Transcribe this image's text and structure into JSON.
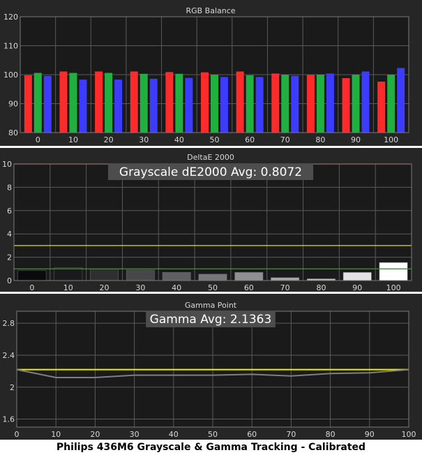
{
  "colors": {
    "background": "#262626",
    "plot_area": "#1a1a1a",
    "gridline": "#5a5a5a",
    "text": "#d9d9d9",
    "red": "#ff2b2b",
    "green": "#20b040",
    "blue": "#3c3cff",
    "threshold_red": "#e03c3c",
    "threshold_yellow": "#e6e600",
    "threshold_green": "#20a020",
    "gamma_line": "#7f7f7f",
    "gamma_target": "#f0f000",
    "annotation_box": "#4d4d4d"
  },
  "caption": "Philips 436M6 Grayscale & Gamma Tracking - Calibrated",
  "chart_data": [
    {
      "type": "bar",
      "title": "RGB Balance",
      "categories": [
        "0",
        "10",
        "20",
        "30",
        "40",
        "50",
        "60",
        "70",
        "80",
        "90",
        "100"
      ],
      "ylim": [
        80,
        120
      ],
      "yticks": [
        80,
        90,
        100,
        110,
        120
      ],
      "grid": true,
      "series": [
        {
          "color": "red",
          "values": [
            99.8,
            101.1,
            101.1,
            101.1,
            100.9,
            100.8,
            101.1,
            100.4,
            99.9,
            98.8,
            97.6
          ]
        },
        {
          "color": "green",
          "values": [
            100.6,
            100.6,
            100.6,
            100.3,
            100.3,
            100.0,
            99.8,
            100.0,
            100.0,
            100.0,
            100.0
          ]
        },
        {
          "color": "blue",
          "values": [
            99.6,
            98.3,
            98.3,
            98.6,
            98.9,
            99.2,
            99.2,
            99.6,
            100.4,
            101.1,
            102.3
          ]
        }
      ]
    },
    {
      "type": "bar",
      "title": "DeltaE 2000",
      "annotation": "Grayscale dE2000 Avg: 0.8072",
      "categories": [
        "0",
        "10",
        "20",
        "30",
        "40",
        "50",
        "60",
        "70",
        "80",
        "90",
        "100"
      ],
      "ylim": [
        0,
        10
      ],
      "yticks": [
        0,
        2,
        4,
        6,
        8,
        10
      ],
      "grid": true,
      "thresholds": [
        {
          "value": 10,
          "color": "threshold_red"
        },
        {
          "value": 3,
          "color": "threshold_yellow"
        },
        {
          "value": 1,
          "color": "threshold_green"
        }
      ],
      "values": [
        0.85,
        1.1,
        1.0,
        0.9,
        0.7,
        0.55,
        0.7,
        0.25,
        0.15,
        0.7,
        1.55
      ],
      "bar_colors": [
        "#0a0a0a",
        "#1a1a1a",
        "#2f2f2f",
        "#474747",
        "#5f5f5f",
        "#777777",
        "#8f8f8f",
        "#a7a7a7",
        "#c0c0c0",
        "#e2e2e2",
        "#ffffff"
      ]
    },
    {
      "type": "line",
      "title": "Gamma Point",
      "annotation": "Gamma Avg: 2.1363",
      "x": [
        0,
        10,
        20,
        30,
        40,
        50,
        60,
        70,
        80,
        90,
        100
      ],
      "xticks": [
        0,
        10,
        20,
        30,
        40,
        50,
        60,
        70,
        80,
        90,
        100
      ],
      "xlim": [
        0,
        100
      ],
      "ylim": [
        1.5,
        2.95
      ],
      "yticks": [
        1.6,
        2,
        2.4,
        2.8
      ],
      "grid": true,
      "target": 2.22,
      "values": [
        2.22,
        2.12,
        2.12,
        2.15,
        2.15,
        2.15,
        2.16,
        2.14,
        2.17,
        2.18,
        2.22
      ]
    }
  ]
}
